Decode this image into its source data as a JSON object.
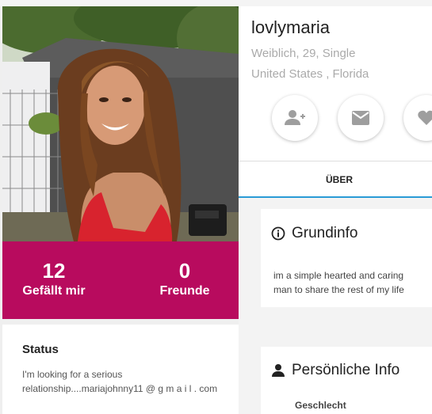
{
  "profile": {
    "username": "lovlymaria",
    "meta_line1": "Weiblich, 29, Single",
    "meta_line2": "United States , Florida"
  },
  "stats": {
    "likes_count": "12",
    "likes_label": "Gefällt mir",
    "friends_count": "0",
    "friends_label": "Freunde"
  },
  "status": {
    "title": "Status",
    "text": "I'm looking for a serious relationship....mariajohnny11 @ g m a i l . com"
  },
  "actions": {
    "add_friend_icon": "person-add-icon",
    "message_icon": "mail-icon",
    "like_icon": "heart-icon"
  },
  "tabs": {
    "about": "ÜBER"
  },
  "about": {
    "basic_info_title": "Grundinfo",
    "basic_info_text_line1": "im a simple hearted and caring",
    "basic_info_text_line2": "man to share the rest of my life",
    "personal_info_title": "Persönliche Info",
    "gender_label": "Geschlecht"
  },
  "colors": {
    "accent": "#b80b5e",
    "tab_underline": "#2a9bd6"
  }
}
